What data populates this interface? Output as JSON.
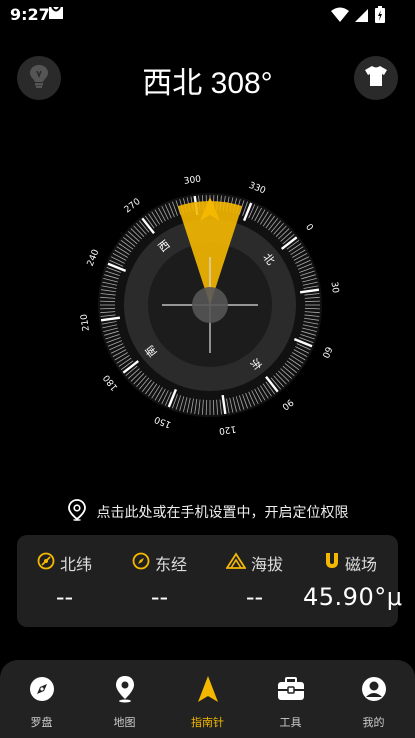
{
  "status_bar": {
    "time": "9:27"
  },
  "header": {
    "title": "西北 308°"
  },
  "compass": {
    "ticks": [
      "0",
      "30",
      "60",
      "90",
      "120",
      "150",
      "180",
      "210",
      "240",
      "270",
      "300",
      "330"
    ],
    "directions": {
      "north": "北",
      "east": "东",
      "south": "南",
      "west": "西"
    },
    "heading_degrees": 308
  },
  "permission": {
    "text": "点击此处或在手机设置中，开启定位权限"
  },
  "info": [
    {
      "label": "北纬",
      "value": "--",
      "icon": "latitude-icon"
    },
    {
      "label": "东经",
      "value": "--",
      "icon": "longitude-icon"
    },
    {
      "label": "海拔",
      "value": "--",
      "icon": "altitude-icon"
    },
    {
      "label": "磁场",
      "value": "45.90°μ",
      "icon": "magnet-icon"
    }
  ],
  "nav": [
    {
      "label": "罗盘",
      "icon": "compass-icon"
    },
    {
      "label": "地图",
      "icon": "map-pin-icon"
    },
    {
      "label": "指南针",
      "icon": "arrow-icon",
      "active": true
    },
    {
      "label": "工具",
      "icon": "toolbox-icon"
    },
    {
      "label": "我的",
      "icon": "person-icon"
    }
  ],
  "colors": {
    "accent": "#f5b800",
    "background": "#000000",
    "card": "#202020"
  }
}
